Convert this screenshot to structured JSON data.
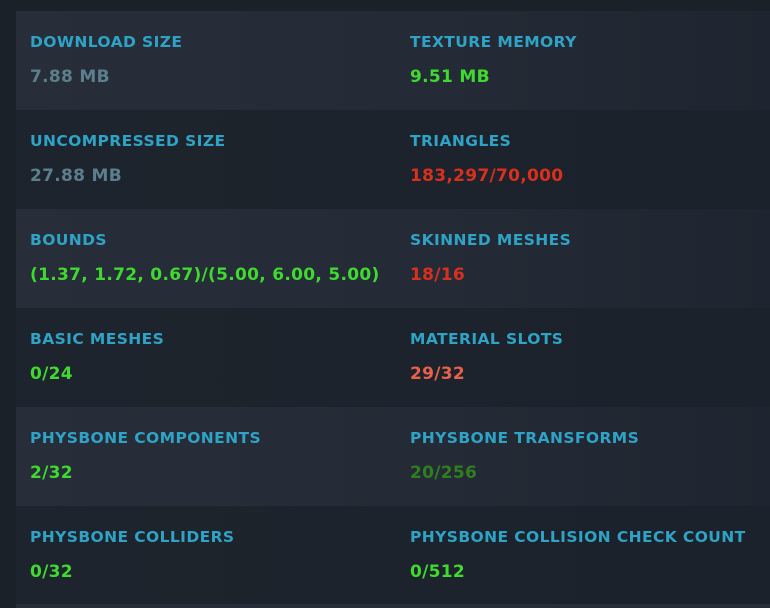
{
  "colors": {
    "label": "#2fa3c6",
    "neutral": "#5b7f8d",
    "good": "#3fd92f",
    "bad": "#d9301e",
    "warn": "#e8614a",
    "dim": "#2f7f1f"
  },
  "stats": {
    "download_size": {
      "label": "DOWNLOAD SIZE",
      "value": "7.88 MB"
    },
    "texture_memory": {
      "label": "TEXTURE MEMORY",
      "value": "9.51 MB"
    },
    "uncompressed_size": {
      "label": "UNCOMPRESSED SIZE",
      "value": "27.88 MB"
    },
    "triangles": {
      "label": "TRIANGLES",
      "value": "183,297/70,000"
    },
    "bounds": {
      "label": "BOUNDS",
      "value": "(1.37, 1.72, 0.67)/(5.00, 6.00, 5.00)"
    },
    "skinned_meshes": {
      "label": "SKINNED MESHES",
      "value": "18/16"
    },
    "basic_meshes": {
      "label": "BASIC MESHES",
      "value": "0/24"
    },
    "material_slots": {
      "label": "MATERIAL SLOTS",
      "value": "29/32"
    },
    "physbone_components": {
      "label": "PHYSBONE COMPONENTS",
      "value": "2/32"
    },
    "physbone_transforms": {
      "label": "PHYSBONE TRANSFORMS",
      "value": "20/256"
    },
    "physbone_colliders": {
      "label": "PHYSBONE COLLIDERS",
      "value": "0/32"
    },
    "physbone_collision_check_count": {
      "label": "PHYSBONE COLLISION CHECK COUNT",
      "value": "0/512"
    }
  }
}
